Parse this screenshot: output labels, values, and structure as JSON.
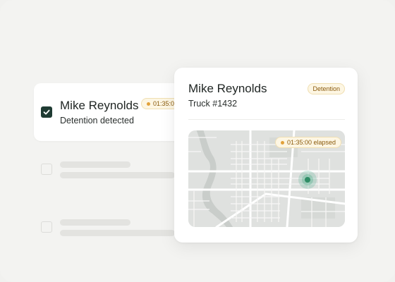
{
  "list": {
    "selected": {
      "name": "Mike Reynolds",
      "status": "Detention detected",
      "timer": "01:35:00",
      "checked": true
    }
  },
  "detail": {
    "name": "Mike Reynolds",
    "truck": "Truck #1432",
    "badge": "Detention",
    "timer": "01:35:00 elapsed"
  },
  "colors": {
    "accent": "#1f3b33",
    "marker": "#2f8d66",
    "badge_bg": "#fdf6e3",
    "badge_text": "#8a5a0c"
  },
  "icons": {
    "checkbox": "check-icon",
    "marker": "location-marker-icon",
    "timer_dot": "status-dot-icon"
  }
}
